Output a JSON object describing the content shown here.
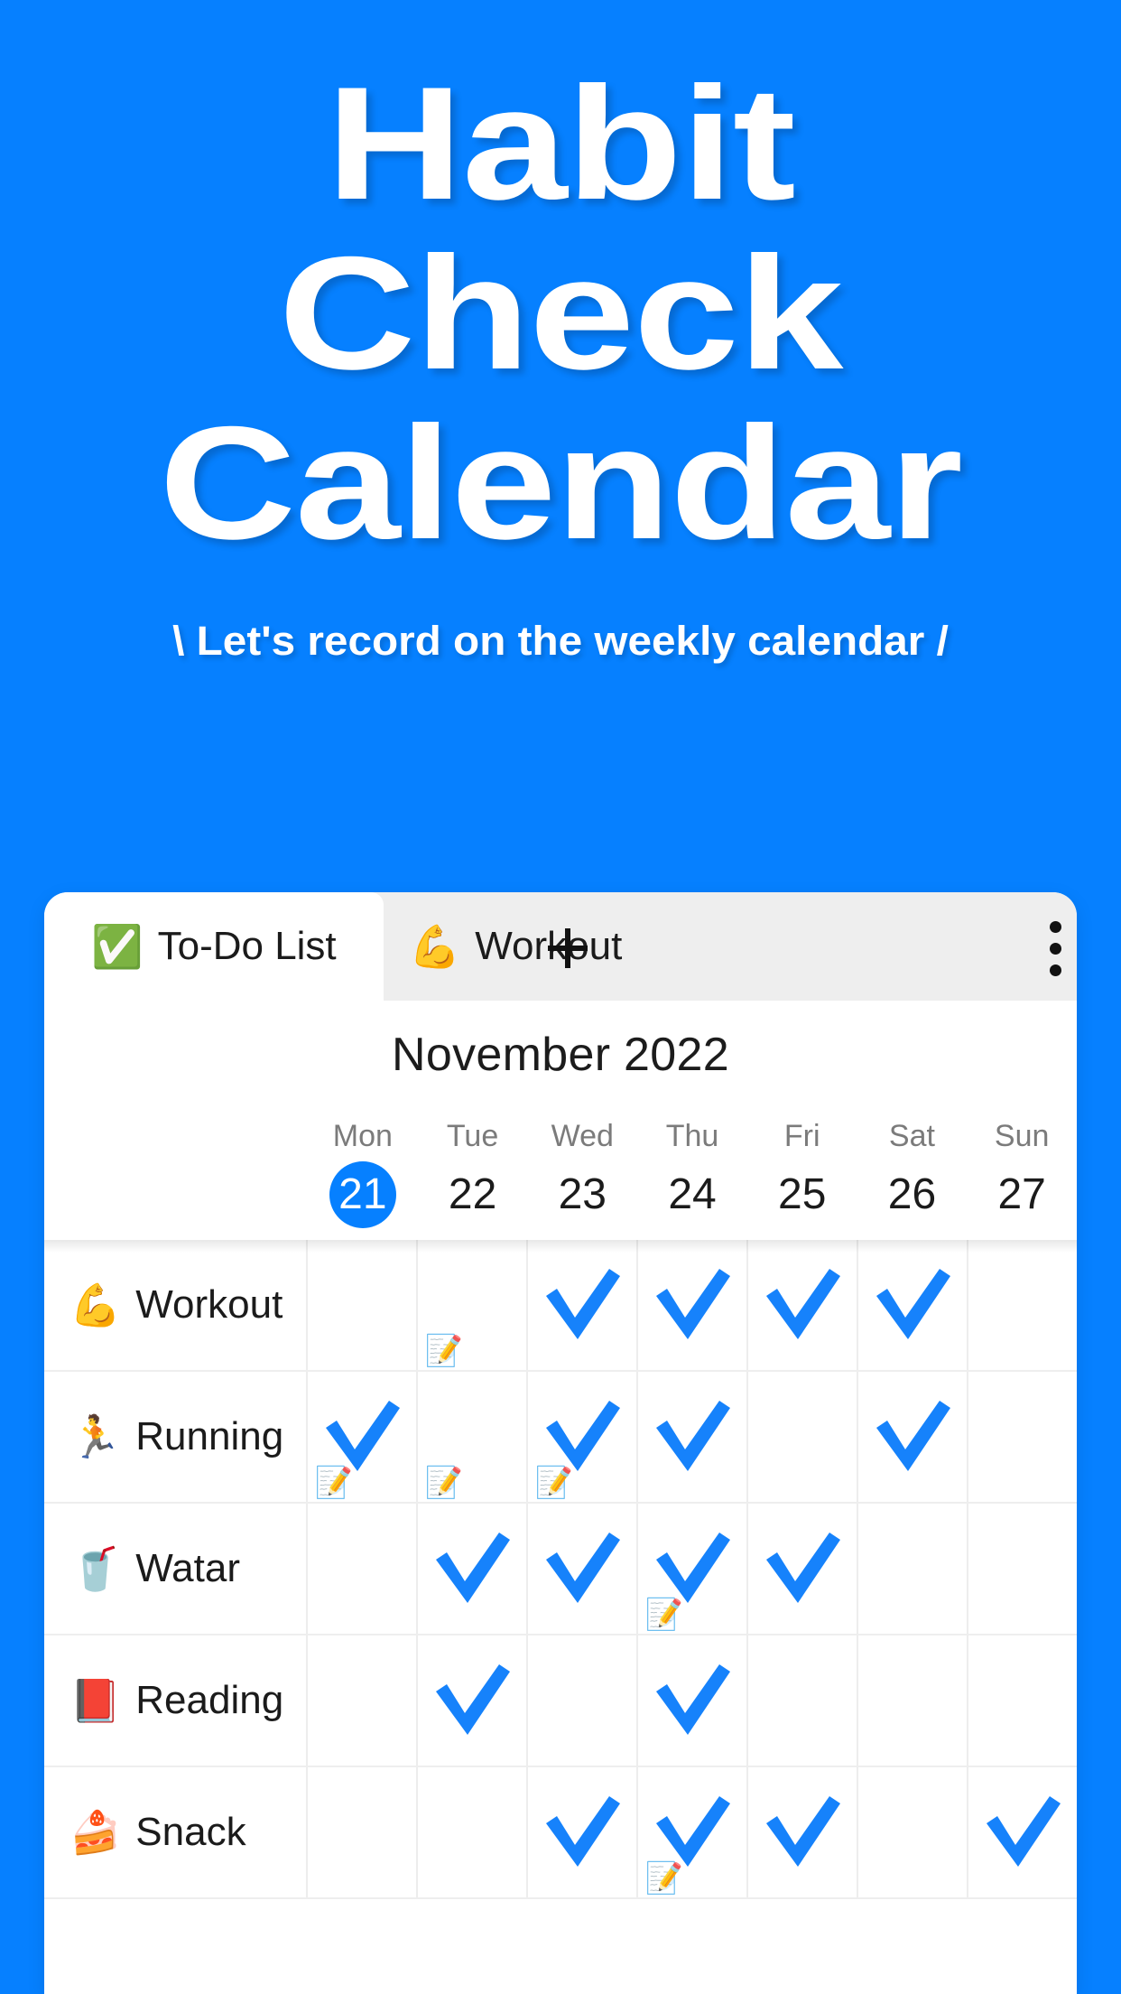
{
  "hero": {
    "title_lines": [
      "Habit",
      "Check",
      "Calendar"
    ],
    "subtitle": "\\ Let's record on the weekly calendar /",
    "bg_color": "#0680ff",
    "text_color": "#ffffff"
  },
  "app": {
    "tabs": [
      {
        "emoji": "✅",
        "label": "To-Do List",
        "active": true
      },
      {
        "emoji": "💪",
        "label": "Workout",
        "active": false
      }
    ],
    "add_tab_icon": "plus-icon",
    "overflow_icon": "kebab-menu-icon",
    "accent_color": "#0680ff"
  },
  "calendar": {
    "month_label": "November 2022",
    "weekdays": [
      "Mon",
      "Tue",
      "Wed",
      "Thu",
      "Fri",
      "Sat",
      "Sun"
    ],
    "dates": [
      "21",
      "22",
      "23",
      "24",
      "25",
      "26",
      "27"
    ],
    "selected_date_index": 0,
    "check_icon": "check-mark-icon",
    "memo_icon": "📝",
    "check_color": "#1682fb"
  },
  "habits": [
    {
      "emoji": "💪",
      "name": "Workout",
      "checks": [
        false,
        false,
        true,
        true,
        true,
        true,
        false
      ],
      "memos": [
        false,
        true,
        false,
        false,
        false,
        false,
        false
      ]
    },
    {
      "emoji": "🏃",
      "name": "Running",
      "checks": [
        true,
        false,
        true,
        true,
        false,
        true,
        false
      ],
      "memos": [
        true,
        true,
        true,
        false,
        false,
        false,
        false
      ]
    },
    {
      "emoji": "🥤",
      "name": "Watar",
      "checks": [
        false,
        true,
        true,
        true,
        true,
        false,
        false
      ],
      "memos": [
        false,
        false,
        false,
        true,
        false,
        false,
        false
      ]
    },
    {
      "emoji": "📕",
      "name": "Reading",
      "checks": [
        false,
        true,
        false,
        true,
        false,
        false,
        false
      ],
      "memos": [
        false,
        false,
        false,
        false,
        false,
        false,
        false
      ]
    },
    {
      "emoji": "🍰",
      "name": "Snack",
      "checks": [
        false,
        false,
        true,
        true,
        true,
        false,
        true
      ],
      "memos": [
        false,
        false,
        false,
        true,
        false,
        false,
        false
      ]
    }
  ]
}
